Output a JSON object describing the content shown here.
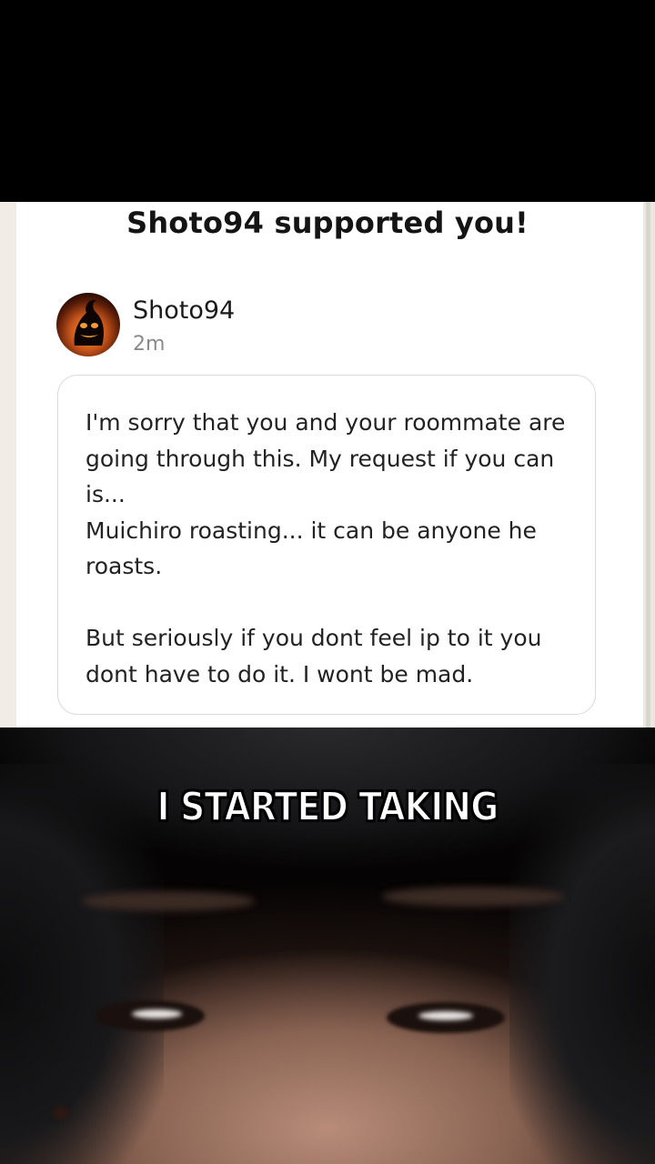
{
  "notification": {
    "heading": "Shoto94 supported you!",
    "author": "Shoto94",
    "time": "2m",
    "avatar_icon": "pumpkin-king-avatar",
    "message": "I'm sorry that you and your roommate are going through this. My request if you can is...\nMuichiro roasting... it can be anyone he roasts.\n\nBut seriously if you dont feel ip to it you dont have to do it. I wont be mad."
  },
  "video": {
    "caption": "I STARTED TAKING"
  },
  "colors": {
    "background_outer": "#000000",
    "card_bg": "#ffffff",
    "page_bg": "#f1ede6",
    "text_primary": "#141414",
    "text_muted": "#8a8a8a",
    "border": "#d9d9d9"
  }
}
